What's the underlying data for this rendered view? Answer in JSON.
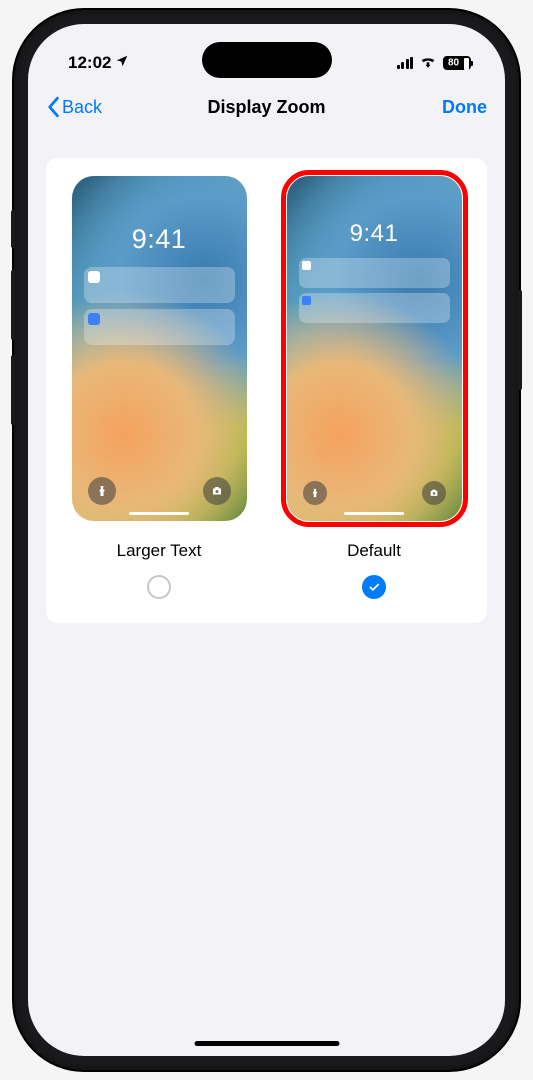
{
  "status": {
    "time": "12:02",
    "battery": "80"
  },
  "nav": {
    "back": "Back",
    "title": "Display Zoom",
    "done": "Done"
  },
  "preview_time": "9:41",
  "options": {
    "larger": {
      "label": "Larger Text",
      "selected": false
    },
    "default": {
      "label": "Default",
      "selected": true,
      "highlighted": true
    }
  },
  "colors": {
    "accent": "#007aff",
    "highlight": "#ff0000"
  }
}
